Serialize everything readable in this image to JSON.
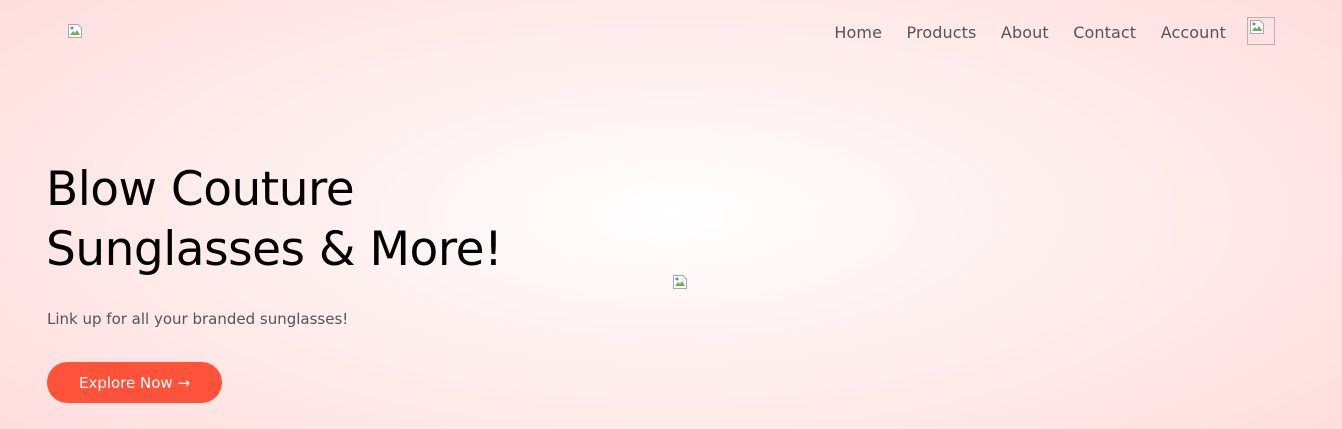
{
  "nav": {
    "links": [
      "Home",
      "Products",
      "About",
      "Contact",
      "Account"
    ]
  },
  "hero": {
    "title_line1": "Blow Couture",
    "title_line2": "Sunglasses & More!",
    "subtitle": "Link up for all your branded sunglasses!",
    "cta_label": "Explore Now →"
  },
  "colors": {
    "accent": "#ff523b",
    "background_edge": "#ffd9d9",
    "nav_text": "#555555"
  },
  "icons": {
    "logo": "broken-image-icon",
    "cart": "broken-image-icon",
    "hero_image": "broken-image-icon"
  }
}
